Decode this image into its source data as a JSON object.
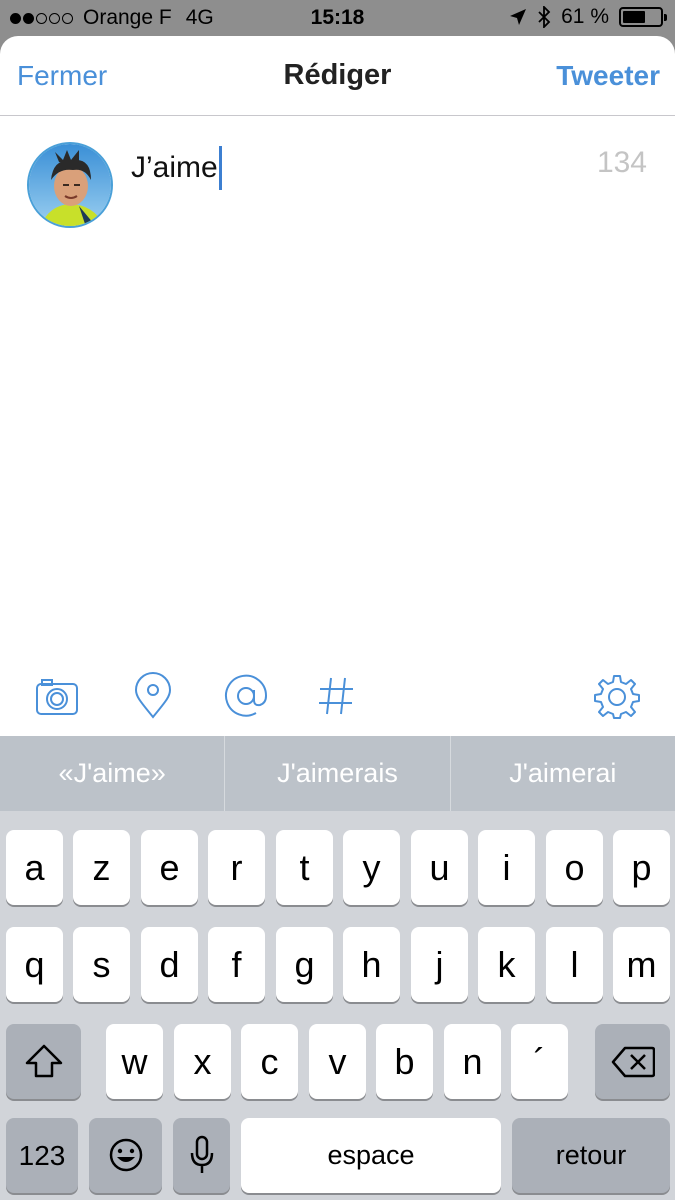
{
  "status_bar": {
    "carrier": "Orange F",
    "network": "4G",
    "time": "15:18",
    "battery": "61 %",
    "battery_level": 0.61,
    "signal_bars": 2,
    "signal_total": 5
  },
  "nav": {
    "left_label": "Fermer",
    "title": "Rédiger",
    "right_label": "Tweeter"
  },
  "compose": {
    "text": "J’aime",
    "char_count": "134"
  },
  "toolbar": {
    "icons": [
      "camera-icon",
      "location-pin-icon",
      "mention-icon",
      "hashtag-icon",
      "settings-gear-icon"
    ]
  },
  "suggestions": [
    "«J'aime»",
    "J'aimerais",
    "J'aimerai"
  ],
  "keyboard": {
    "row1": [
      "a",
      "z",
      "e",
      "r",
      "t",
      "y",
      "u",
      "i",
      "o",
      "p"
    ],
    "row2": [
      "q",
      "s",
      "d",
      "f",
      "g",
      "h",
      "j",
      "k",
      "l",
      "m"
    ],
    "row3": [
      "w",
      "x",
      "c",
      "v",
      "b",
      "n",
      "´"
    ],
    "numbers_label": "123",
    "space_label": "espace",
    "return_label": "retour"
  },
  "colors": {
    "accent": "#4a90d9",
    "status_bar_bg": "#8e8e8e",
    "suggestion_bar": "#bcc2c9",
    "keyboard_bg": "#d1d4d9"
  }
}
